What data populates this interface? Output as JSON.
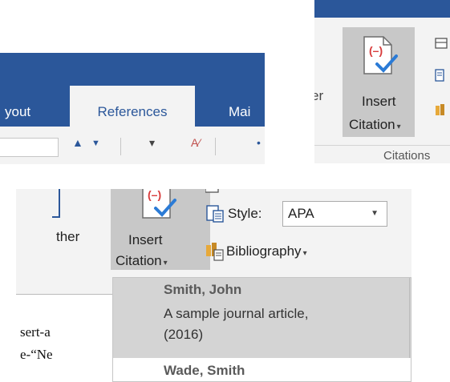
{
  "panelA": {
    "tabs": [
      "yout",
      "References",
      "Mai"
    ],
    "active_tab": "References",
    "colors": {
      "tab_bar": "#2b579a",
      "ribbon": "#f3f3f3"
    }
  },
  "panelB": {
    "cut_text": "er",
    "insert_citation": {
      "line1": "Insert",
      "line2": "Citation",
      "caret": "▾"
    },
    "group_label": "Citations",
    "icons": [
      "insert-citation-icon",
      "manage-sources-icon",
      "style-icon",
      "bibliography-icon"
    ]
  },
  "panelC": {
    "cut_text": "ther",
    "insert_citation": {
      "line1": "Insert",
      "line2": "Citation",
      "caret": "▾"
    },
    "style": {
      "label": "Style:",
      "value": "APA"
    },
    "bibliography": {
      "label": "Bibliography",
      "caret": "▾"
    },
    "document_lines": [
      "sert-a",
      "e-“Ne"
    ],
    "citation_menu": [
      {
        "author": "Smith, John",
        "work_line1": "A sample journal article,",
        "work_line2": "(2016)"
      },
      {
        "author": "Wade, Smith"
      }
    ]
  }
}
